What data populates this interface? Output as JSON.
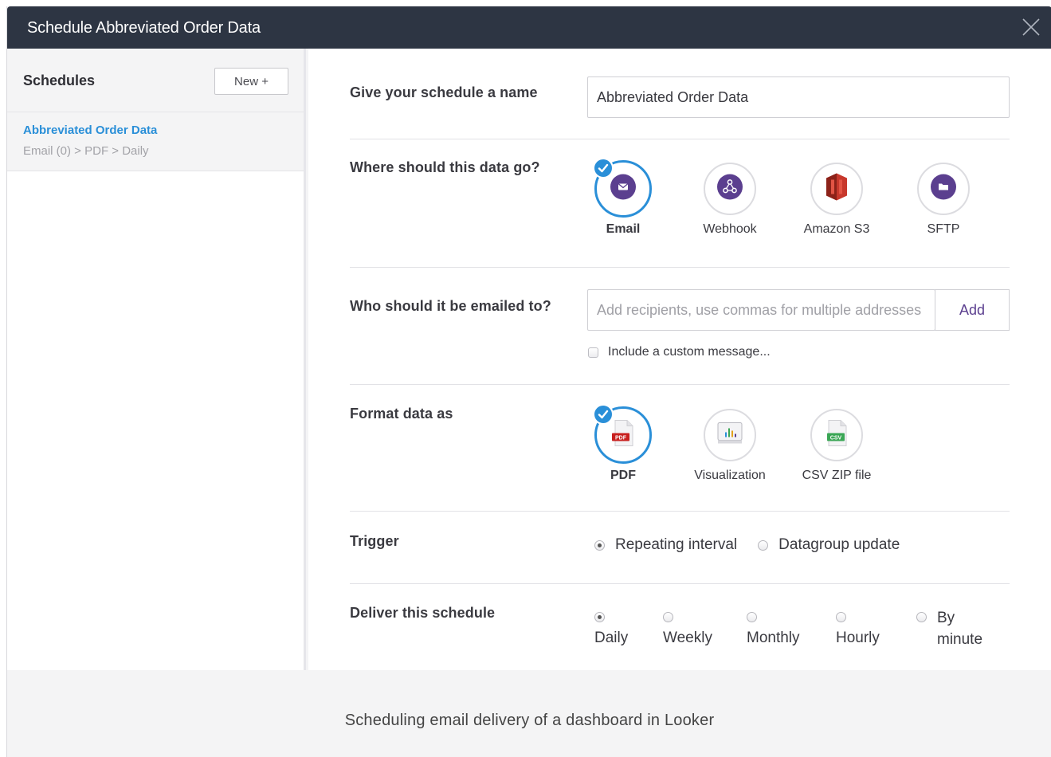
{
  "window": {
    "title": "Schedule Abbreviated Order Data"
  },
  "sidebar": {
    "heading": "Schedules",
    "new_button": "New +",
    "items": [
      {
        "name": "Abbreviated Order Data",
        "path": "Email (0) > PDF > Daily"
      }
    ]
  },
  "form": {
    "name_question": "Give your schedule a name",
    "name_value": "Abbreviated Order Data",
    "destination_question": "Where should this data go?",
    "destinations": [
      {
        "label": "Email",
        "icon": "envelope-icon",
        "selected": true
      },
      {
        "label": "Webhook",
        "icon": "webhook-icon",
        "selected": false
      },
      {
        "label": "Amazon S3",
        "icon": "amazon-s3-icon",
        "selected": false
      },
      {
        "label": "SFTP",
        "icon": "folder-icon",
        "selected": false
      }
    ],
    "recipients_question": "Who should it be emailed to?",
    "recipients_placeholder": "Add recipients, use commas for multiple addresses",
    "add_button": "Add",
    "custom_message_label": "Include a custom message...",
    "format_question": "Format data as",
    "formats": [
      {
        "label": "PDF",
        "icon": "pdf-file-icon",
        "selected": true
      },
      {
        "label": "Visualization",
        "icon": "chart-icon",
        "selected": false
      },
      {
        "label": "CSV ZIP file",
        "icon": "csv-file-icon",
        "selected": false
      }
    ],
    "trigger_question": "Trigger",
    "trigger_options": [
      {
        "label": "Repeating interval",
        "selected": true
      },
      {
        "label": "Datagroup update",
        "selected": false
      }
    ],
    "deliver_question": "Deliver this schedule",
    "deliver_options": [
      {
        "label": "Daily",
        "selected": true
      },
      {
        "label": "Weekly",
        "selected": false
      },
      {
        "label": "Monthly",
        "selected": false
      },
      {
        "label": "Hourly",
        "selected": false
      },
      {
        "label": "By minute",
        "selected": false
      }
    ]
  },
  "caption": "Scheduling email delivery of a dashboard in Looker",
  "colors": {
    "titlebar": "#2d3543",
    "accent": "#2a8fd8",
    "icon_purple": "#5b3f8f",
    "s3_red": "#c7382c"
  }
}
